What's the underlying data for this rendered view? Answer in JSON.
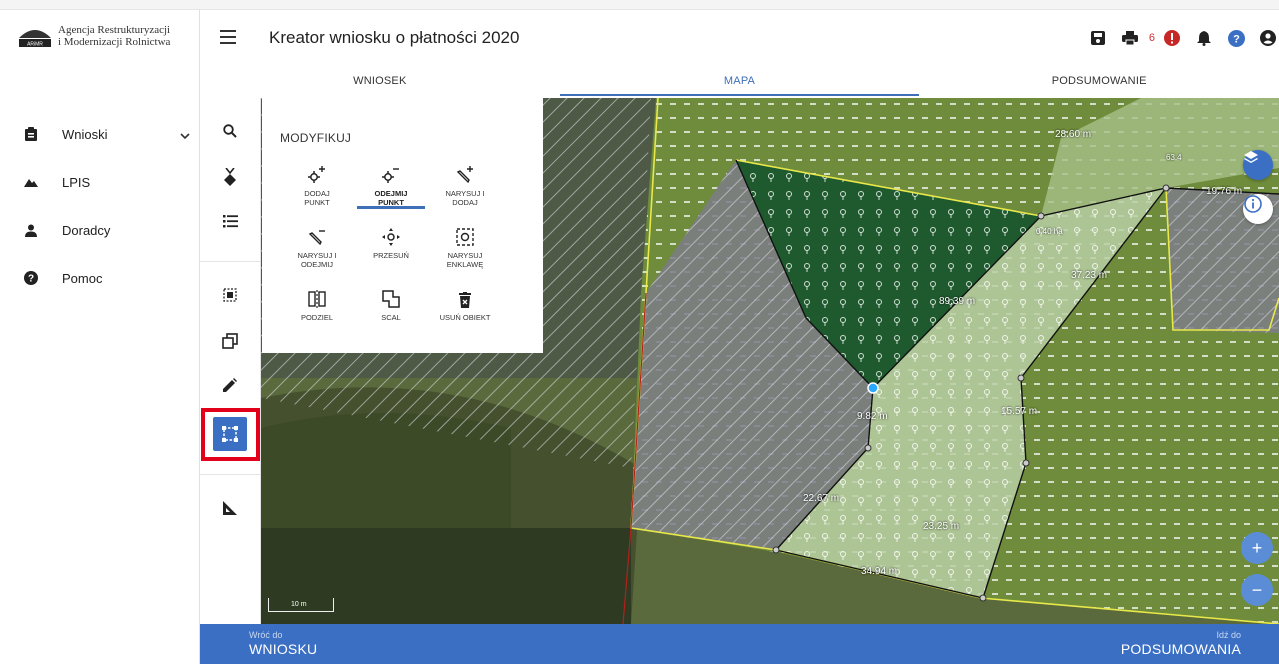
{
  "brand": {
    "line1": "Agencja Restrukturyzacji",
    "line2": "i Modernizacji Rolnictwa",
    "logo_small": "ARiMR"
  },
  "header": {
    "title": "Kreator wniosku o płatności 2020",
    "notification_count": "6"
  },
  "sidebar": {
    "items": [
      {
        "label": "Wnioski",
        "icon": "clipboard-icon"
      },
      {
        "label": "LPIS",
        "icon": "mountains-icon"
      },
      {
        "label": "Doradcy",
        "icon": "person-icon"
      },
      {
        "label": "Pomoc",
        "icon": "help-circle-icon"
      }
    ]
  },
  "tabs": [
    {
      "label": "WNIOSEK"
    },
    {
      "label": "MAPA",
      "active": true
    },
    {
      "label": "PODSUMOWANIE"
    }
  ],
  "panel": {
    "title": "MODYFIKUJ",
    "buttons": [
      {
        "label1": "DODAJ",
        "label2": "PUNKT"
      },
      {
        "label1": "ODEJMIJ",
        "label2": "PUNKT",
        "active": true
      },
      {
        "label1": "NARYSUJ I",
        "label2": "DODAJ"
      },
      {
        "label1": "NARYSUJ I",
        "label2": "ODEJMIJ"
      },
      {
        "label1": "PRZESUŃ",
        "label2": ""
      },
      {
        "label1": "NARYSUJ",
        "label2": "ENKLAWĘ"
      },
      {
        "label1": "PODZIEL",
        "label2": ""
      },
      {
        "label1": "SCAL",
        "label2": ""
      },
      {
        "label1": "USUŃ OBIEKT",
        "label2": ""
      }
    ]
  },
  "map": {
    "scale": "10 m",
    "labels": [
      "28.60 m",
      "63.4",
      "19.76 m",
      "0.40 ha",
      "37.23 m",
      "89.39 m",
      "9.82 m",
      "15.57 m",
      "22.67 m",
      "23.25 m",
      "34.94 m"
    ]
  },
  "footer": {
    "back_small": "Wróć do",
    "back_big": "WNIOSKU",
    "next_small": "Idź do",
    "next_big": "PODSUMOWANIA"
  },
  "colors": {
    "accent": "#3b6fc4",
    "highlight": "#e3001b",
    "alert": "#d32f2f",
    "parcel_outline": "#e8e84a"
  }
}
